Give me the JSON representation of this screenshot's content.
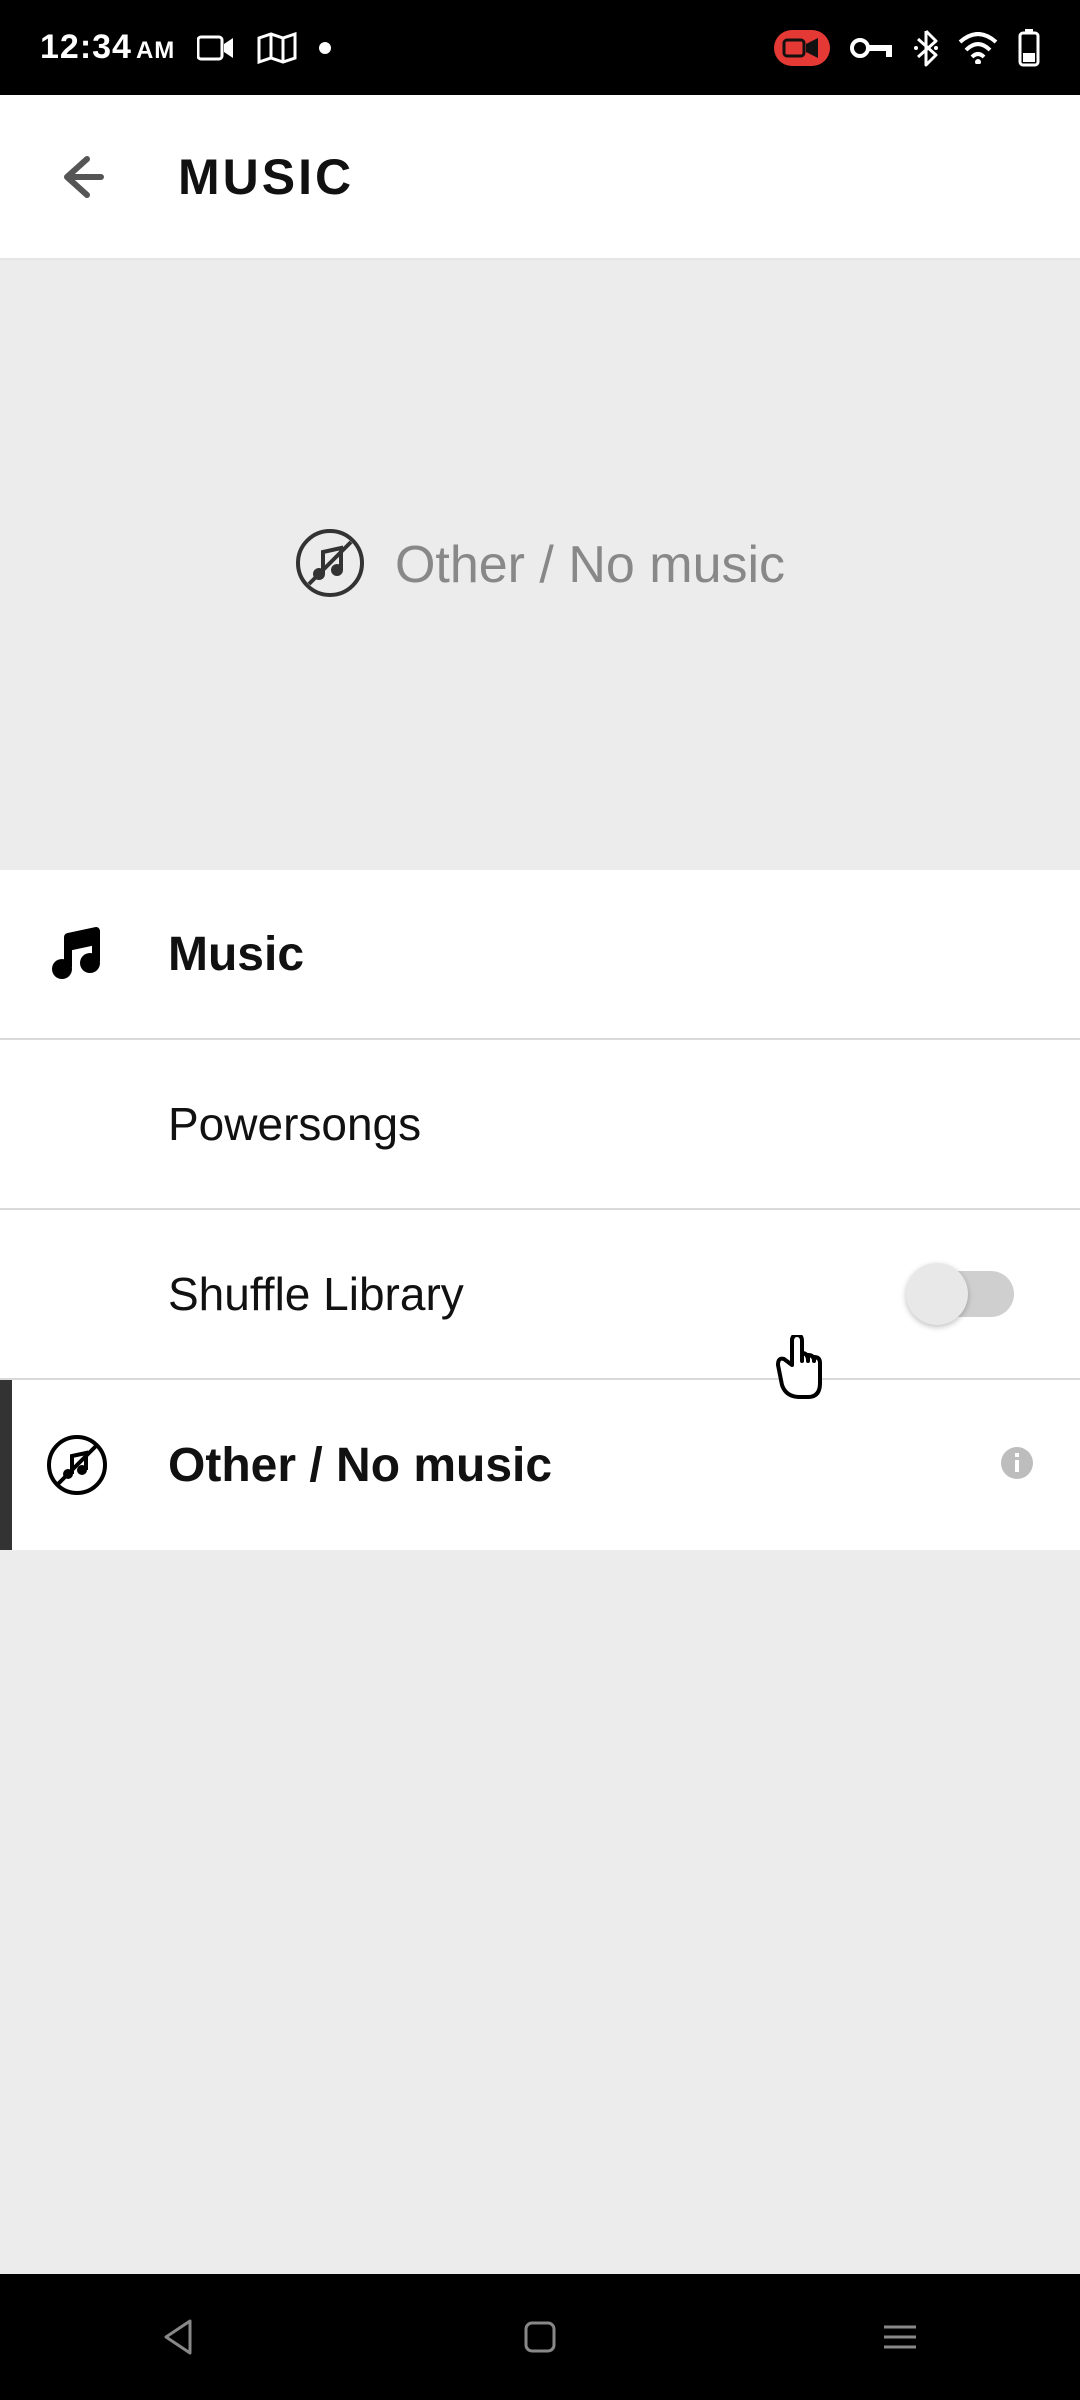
{
  "status": {
    "time": "12:34",
    "ampm": "AM"
  },
  "appbar": {
    "title": "MUSIC"
  },
  "hero": {
    "label": "Other / No music"
  },
  "rows": {
    "music": "Music",
    "powersongs": "Powersongs",
    "shuffle": "Shuffle Library",
    "shuffle_on": false,
    "other": "Other / No music"
  }
}
